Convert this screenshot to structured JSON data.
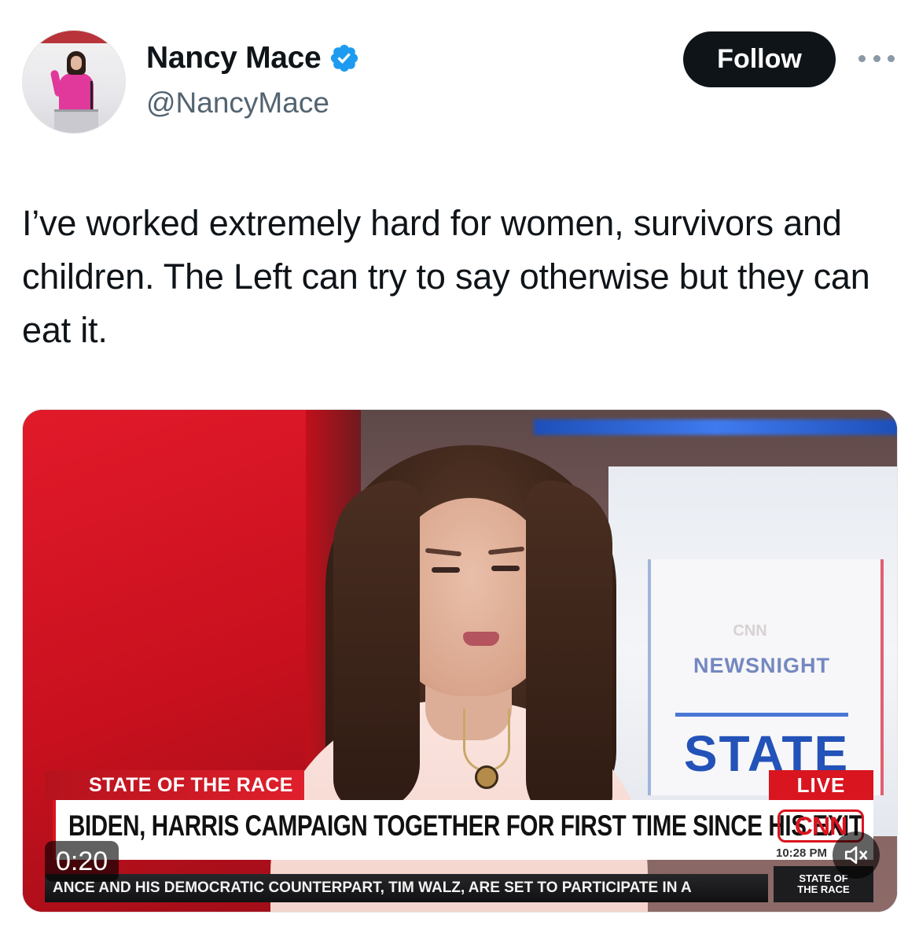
{
  "author": {
    "display_name": "Nancy Mace",
    "handle": "@NancyMace",
    "verified": true,
    "avatar_icon": "profile-photo"
  },
  "actions": {
    "follow_label": "Follow",
    "more_icon": "more-horizontal-icon"
  },
  "tweet": {
    "text": "I’ve worked extremely hard for women, survivors and children. The Left can try to say otherwise but they can eat it."
  },
  "media": {
    "duration": "0:20",
    "mute_icon": "speaker-muted-icon",
    "broadcast": {
      "panel_logo": "CNN",
      "panel_show": "NEWSNIGHT",
      "panel_word": "STATE",
      "chyron_label": "STATE OF THE RACE",
      "live_label": "LIVE",
      "headline": "BIDEN, HARRIS CAMPAIGN TOGETHER FOR FIRST TIME SINCE HIS EXIT",
      "network_logo": "CNN",
      "time": "10:28 PM",
      "ticker": "ANCE AND HIS DEMOCRATIC COUNTERPART, TIM WALZ, ARE SET TO PARTICIPATE IN A",
      "ticker_side_top": "STATE OF",
      "ticker_side_bottom": "THE RACE"
    }
  },
  "colors": {
    "accent_blue": "#1d9bf0",
    "cnn_red": "#d91520",
    "text_primary": "#0f1419",
    "text_secondary": "#536471"
  }
}
